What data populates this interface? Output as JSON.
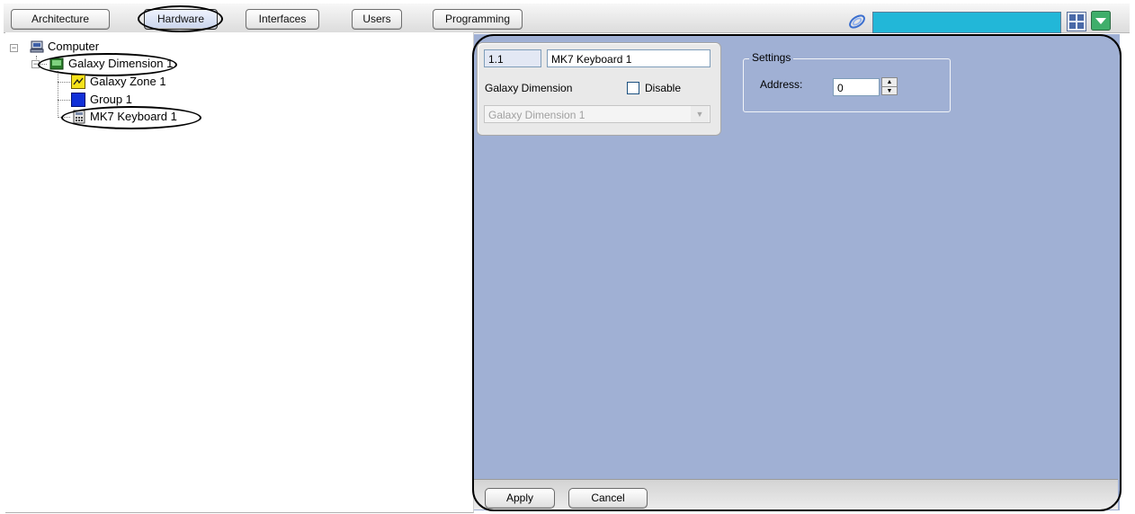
{
  "toolbar": {
    "tabs": [
      {
        "label": "Architecture"
      },
      {
        "label": "Hardware"
      },
      {
        "label": "Interfaces"
      },
      {
        "label": "Users"
      },
      {
        "label": "Programming"
      }
    ],
    "selected_tab": "Hardware",
    "search_color": "#22b7d8",
    "icons": [
      "swirl-icon",
      "grid-layout-icon",
      "dropdown-menu-icon"
    ]
  },
  "tree": {
    "root": {
      "label": "Computer",
      "icon": "computer-icon"
    },
    "controller": {
      "label": "Galaxy Dimension 1",
      "icon": "panel-icon"
    },
    "children": [
      {
        "label": "Galaxy Zone 1",
        "icon": "zone-icon"
      },
      {
        "label": "Group 1",
        "icon": "group-icon"
      },
      {
        "label": "MK7 Keyboard 1",
        "icon": "keyboard-icon"
      }
    ]
  },
  "panel": {
    "object_id": "1.1",
    "object_name": "MK7 Keyboard 1",
    "parent_type_label": "Galaxy Dimension",
    "disable_label": "Disable",
    "disable_checked": false,
    "parent_select_value": "Galaxy Dimension 1",
    "settings_legend": "Settings",
    "address_label": "Address:",
    "address_value": "0",
    "background_color": "#a0b0d4"
  },
  "buttons": {
    "apply_label": "Apply",
    "cancel_label": "Cancel"
  }
}
